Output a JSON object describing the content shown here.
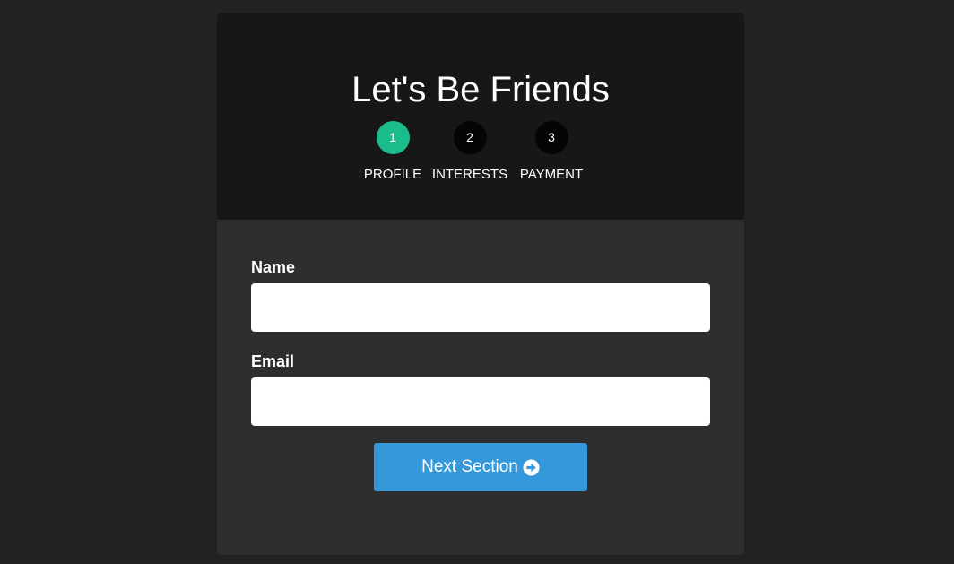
{
  "header": {
    "title": "Let's Be Friends"
  },
  "steps": [
    {
      "number": "1",
      "label": "PROFILE",
      "active": true
    },
    {
      "number": "2",
      "label": "INTERESTS",
      "active": false
    },
    {
      "number": "3",
      "label": "PAYMENT",
      "active": false
    }
  ],
  "form": {
    "name_label": "Name",
    "name_value": "",
    "email_label": "Email",
    "email_value": "",
    "next_button_label": "Next Section",
    "next_button_icon": "arrow-circle-right-icon"
  },
  "colors": {
    "page_background": "#222222",
    "header_background": "#171717",
    "body_background": "#2e2e2e",
    "active_step": "#1abc8c",
    "inactive_step": "#050505",
    "button": "#3498db"
  }
}
